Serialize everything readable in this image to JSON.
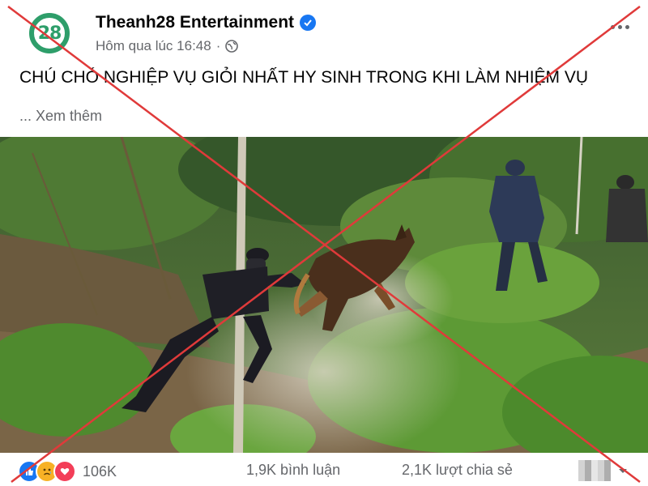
{
  "post": {
    "avatar_text": "28",
    "page_name": "Theanh28 Entertainment",
    "timestamp": "Hôm qua lúc 16:48",
    "separator": "·",
    "caption": "CHÚ CHÓ NGHIỆP VỤ GIỎI NHẤT HY SINH TRONG KHI LÀM NHIỆM VỤ",
    "see_more": "... Xem thêm"
  },
  "footer": {
    "reaction_icons": [
      "like-icon",
      "sad-icon",
      "love-icon"
    ],
    "reaction_count": "106K",
    "comments": "1,9K bình luận",
    "shares": "2,1K lượt chia sẻ"
  },
  "colors": {
    "brand_green": "#2e9e6a",
    "facebook_blue": "#1877f2",
    "cross_red": "#e03a3a",
    "secondary_text": "#65676b"
  }
}
